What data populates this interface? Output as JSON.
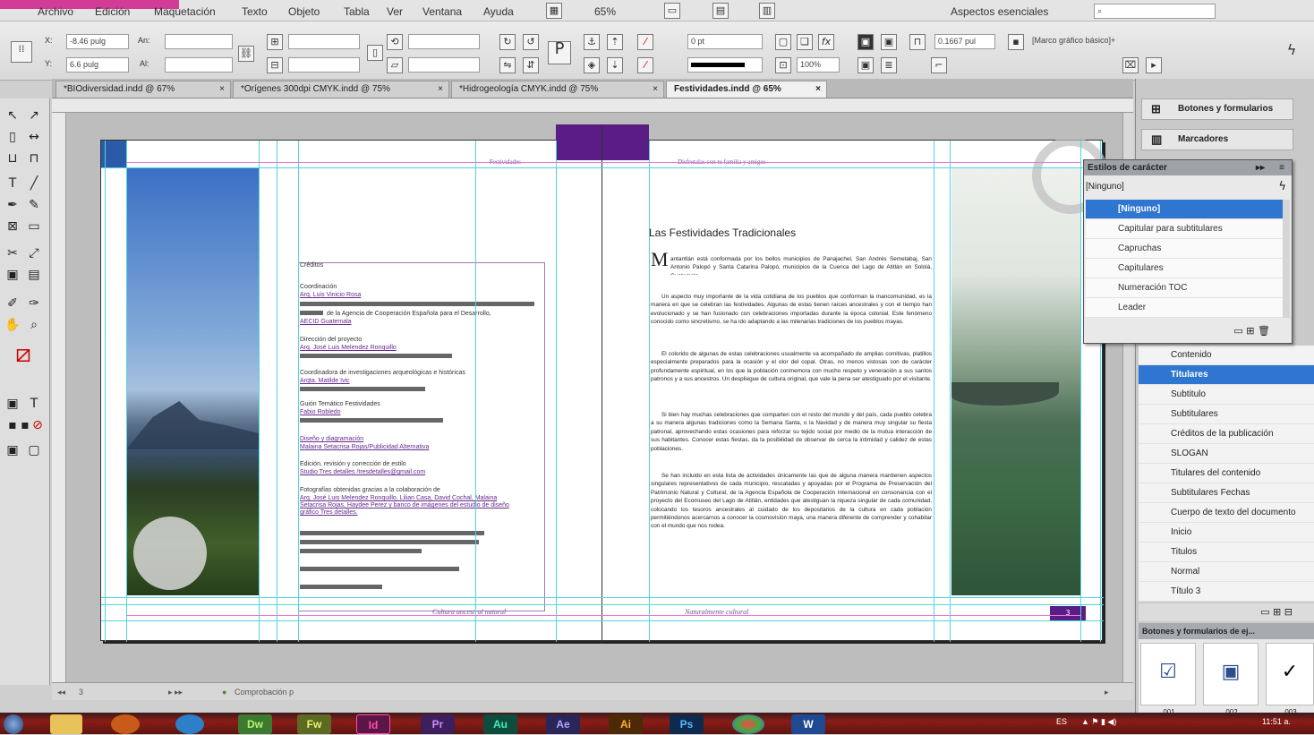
{
  "menubar": {
    "items": [
      "Archivo",
      "Edición",
      "Maquetación",
      "Texto",
      "Objeto",
      "Tabla",
      "Ver",
      "Ventana",
      "Ayuda"
    ],
    "zoom": "65%",
    "workspace": "Aspectos esenciales"
  },
  "control": {
    "x": "-8.46 pulg",
    "y": "6.6 pulg",
    "w_label": "An:",
    "h_label": "Al:",
    "stroke_weight": "0 pt",
    "scale": "100%",
    "gutter": "0.1667 pul",
    "frame_style": "[Marco gráfico básico]+"
  },
  "tabs": [
    {
      "label": "*BIOdiversidad.indd @ 67%",
      "close": "×"
    },
    {
      "label": "*Orígenes 300dpi CMYK.indd @ 75%",
      "close": "×"
    },
    {
      "label": "*Hidrogeología CMYK.indd @ 75%",
      "close": "×"
    },
    {
      "label": "Festividades.indd @ 65%",
      "close": "×"
    }
  ],
  "spread": {
    "running_head_left": "Festividades",
    "running_head_right": "Disfrutalas con tu familia y amigos",
    "credits_title": "Créditos",
    "credits": [
      {
        "role": "Coordinación",
        "name": "Arq. Luis Vinicio Rosa"
      },
      {
        "role": "de la Agencia de Cooperación Española para el Desarrollo,",
        "name": "AECID Guatemala"
      },
      {
        "role": "Dirección del proyecto",
        "name": "Arq. José Luis Melendez Ronquillo"
      },
      {
        "role": "Coordinadora de investigaciones arqueológicas e históricas",
        "name": "Arqta. Matilde Ivic"
      },
      {
        "role": "Guión Temático Festividades",
        "name": "Fabio Robledo"
      },
      {
        "role": "Diseño y diagramación",
        "name": "Malaina Setacrisa Rojas/Publicidad Alternativa"
      },
      {
        "role": "Edición, revisión y corrección de estilo",
        "name": "Studio Tres detalles /tresdetalles@gmail.com"
      },
      {
        "role": "Fotografías obtenidas gracias a la colaboración de",
        "name": "Arq. José Luis Melendez Ronquillo, Lilian Casa, David Cochal, Malaina Setacrisa Rojas, Haydee Perez y banco de imágenes del estudio de diseño gráfico Tres detalles."
      }
    ],
    "article_title": "Las Festividades Tradicionales",
    "drop_cap": "M",
    "paragraphs": [
      "antantlán está conformada por los bellos municipios de Panajachel, San Andrés Semetabaj, San Antonio Palopó y Santa Catarina Palopó, municipios de la Cuenca del Lago de Atitlán en Sololá, Guatemala.",
      "Un aspecto muy importante de la vida cotidiana de los pueblos que conforman la mancomunidad, es la manera en que se celebran las festividades. Algunas de estas tienen raíces ancestrales y con el tiempo han evolucionado y se han fusionado con celebraciones importadas durante la época colonial. Este fenómeno conocido como sincretismo, se ha ido adaptando a las milenarias tradiciones de los pueblos mayas.",
      "El colorido de algunas de estas celebraciones usualmente va acompañado de amplias comitivas, platillos especialmente preparados para la ocasión y el olor del copal. Otras, no menos vistosas son de carácter profundamente espiritual, en los que la población conmemora con mucho respeto y veneración a sus santos patronos y a sus ancestros. Un despliegue de cultura original, que vale la pena ser atestiguado por el visitante.",
      "Si bien hay muchas celebraciones que comparten con el resto del mundo y del país, cada pueblo celebra a su manera algunas tradiciones como la Semana Santa, o la Navidad y de manera muy singular su fiesta patronal, aprovechando estas ocasiones para reforzar su tejido social por medio de la mutua interacción de sus habitantes. Conocer estas fiestas, da la posibilidad de observar de cerca la intimidad y calidez de estas poblaciones.",
      "Se han incluido en esta lista de actividades únicamente las que de alguna manera mantienen aspectos singulares representativos de cada municipio, rescatadas y apoyadas por el Programa de Preservación del Patrimonio Natural y Cultural, de la Agencia Española de Cooperación Internacional en consonancia con el proyecto del Ecomuseo del Lago de Atitlán, entidades que atestiguan la riqueza singular de cada comunidad, colocando los tesoros ancestrales al cuidado de los depositarios de la cultura en cada población permitiéndonos acercarnos a conocer la cosmovisión maya, una manera diferente de comprender y cohabitar con el mundo que nos rodea."
    ],
    "folio_left": "Cultura ancestral natural",
    "folio_right": "Naturalmente cultural",
    "page_number": "3"
  },
  "panels": {
    "buttons_forms": "Botones y formularios",
    "bookmarks": "Marcadores",
    "char_styles_title": "Estilos de carácter",
    "char_styles_current": "[Ninguno]",
    "char_styles": [
      "[Ninguno]",
      "Capitular para subtitulares",
      "Capruchas",
      "Capitulares",
      "Numeración TOC",
      "Leader"
    ],
    "para_styles": [
      "Contenido",
      "Titulares",
      "Subtitulo",
      "Subtitulares",
      "Créditos de la publicación",
      "SLOGAN",
      "Titulares del contenido",
      "Subtitulares Fechas",
      "Cuerpo de texto del documento",
      "Inicio",
      "Titulos",
      "Normal",
      "Título 3"
    ],
    "sample_buttons_title": "Botones y formularios de ej...",
    "samples": [
      {
        "label": "001",
        "glyph": "☑"
      },
      {
        "label": "002",
        "glyph": "▣"
      },
      {
        "label": "003",
        "glyph": "✓"
      }
    ]
  },
  "status": {
    "page": "3",
    "preflight": "Comprobación p"
  },
  "taskbar": {
    "apps": [
      {
        "label": "Dw",
        "bg": "#3b7a2f",
        "fg": "#b9f36e"
      },
      {
        "label": "Fw",
        "bg": "#5d6a23",
        "fg": "#e8f36e"
      },
      {
        "label": "Id",
        "bg": "#5b1646",
        "fg": "#ff4fb0"
      },
      {
        "label": "Pr",
        "bg": "#3c1f5c",
        "fg": "#c88cff"
      },
      {
        "label": "Au",
        "bg": "#0e4d3e",
        "fg": "#3ff0b7"
      },
      {
        "label": "Ae",
        "bg": "#2a2659",
        "fg": "#b2a6ff"
      },
      {
        "label": "Ai",
        "bg": "#4d2a07",
        "fg": "#ffb133"
      },
      {
        "label": "Ps",
        "bg": "#0f2a4f",
        "fg": "#59b7ff"
      },
      {
        "label": "W",
        "bg": "#1f4a92",
        "fg": "#ffffff"
      }
    ],
    "lang": "ES",
    "time": "11:51 a."
  }
}
